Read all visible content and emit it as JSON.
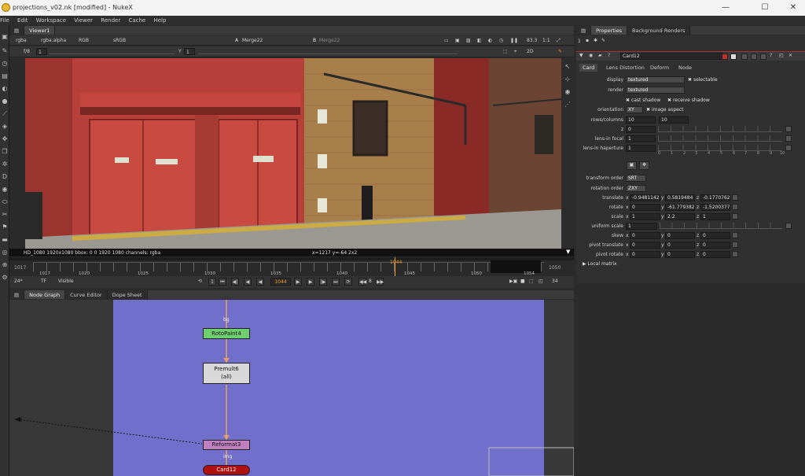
{
  "window": {
    "title": "projections_v02.nk [modified] - NukeX",
    "minimize": "—",
    "maximize": "☐",
    "close": "✕"
  },
  "menu": [
    "File",
    "Edit",
    "Workspace",
    "Viewer",
    "Render",
    "Cache",
    "Help"
  ],
  "viewer": {
    "tab": "Viewer1",
    "channels": "rgba",
    "alpha": "rgba.alpha",
    "display_channel": "RGB",
    "lut": "sRGB",
    "input_a_label": "A",
    "input_a": "Merge22",
    "input_b_label": "B",
    "input_b": "Merge22",
    "zoom": "83.3",
    "ratio": "1:1",
    "fstop": "f/8",
    "gain_value": "1",
    "gamma_label": "Y",
    "gamma_value": "1",
    "view_mode": "2D",
    "info_left": "HD_1080 1920x1080  bbox: 0 0 1920 1080 channels: rgba",
    "info_coords": "x=1217 y=-64 2x2"
  },
  "timeline": {
    "start": "1017",
    "end": "1050",
    "current": "1044",
    "ticks": [
      "1017",
      "1020",
      "1025",
      "1030",
      "1035",
      "1040",
      "1045",
      "1050",
      "1054"
    ],
    "fps": "24*",
    "tf": "TF",
    "visibility": "Visible",
    "frame_field": "1044",
    "step": "8",
    "end_field": "34"
  },
  "graph": {
    "tabs": [
      "Node Graph",
      "Curve Editor",
      "Dope Sheet"
    ],
    "nodes": {
      "roto": "RotoPaint4",
      "premult_name": "Premult6",
      "premult_sub": "(all)",
      "reformat": "Reformat3",
      "card": "Card12"
    },
    "edge_label_bg": "bg",
    "edge_label_img": "img",
    "pipe_number": "2"
  },
  "properties": {
    "tabs": [
      "Properties",
      "Background Renders"
    ],
    "max_panels": "1",
    "node_name": "Card12",
    "node_tabs": [
      "Card",
      "Lens Distortion",
      "Deform",
      "Node"
    ],
    "display_label": "display",
    "display_value": "textured",
    "selectable": "selectable",
    "render_label": "render",
    "render_value": "textured",
    "cast_shadow": "cast shadow",
    "receive_shadow": "receive shadow",
    "orientation_label": "orientation",
    "orientation_value": "XY",
    "image_aspect": "image aspect",
    "rows_label": "rows/columns",
    "rows": "10",
    "columns": "10",
    "z_label": "z",
    "z_value": "0",
    "lens_focal_label": "lens-in focal",
    "lens_focal_value": "1",
    "lens_haperture_label": "lens-in haperture",
    "lens_haperture_value": "1",
    "slider_ticks": [
      "0",
      "1",
      "2",
      "3",
      "4",
      "5",
      "6",
      "7",
      "8",
      "9",
      "10"
    ],
    "transform_order_label": "transform order",
    "transform_order_value": "SRT",
    "rotation_order_label": "rotation order",
    "rotation_order_value": "ZXY",
    "translate_label": "translate",
    "translate_x": "-0.94811422",
    "translate_y": "0.5819484",
    "translate_z": "-0.17707625",
    "rotate_label": "rotate",
    "rotate_x": "0",
    "rotate_y": "-61.7793826",
    "rotate_z": "-1.52003779",
    "scale_label": "scale",
    "scale_x": "1",
    "scale_y": "2.2",
    "scale_z": "1",
    "uniform_scale_label": "uniform scale",
    "uniform_scale_value": "1",
    "skew_label": "skew",
    "skew_x": "0",
    "skew_y": "0",
    "skew_z": "0",
    "pivot_translate_label": "pivot translate",
    "pt_x": "0",
    "pt_y": "0",
    "pt_z": "0",
    "pivot_rotate_label": "pivot rotate",
    "pr_x": "0",
    "pr_y": "0",
    "pr_z": "0",
    "local_matrix": "Local matrix",
    "axis_x": "x",
    "axis_y": "y",
    "axis_z": "z"
  },
  "colors": {
    "backdrop": "#7070cc",
    "roto_node": "#6fcf6f",
    "premult_node": "#d8d8d8",
    "reformat_node": "#c080c0",
    "card_node": "#b01010",
    "pipe": "#e8a060",
    "current_frame": "#f0a030"
  }
}
